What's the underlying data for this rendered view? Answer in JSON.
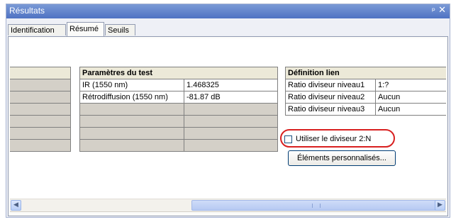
{
  "window": {
    "title": "Résultats",
    "pin_glyph": "ᵖ",
    "close_glyph": "✕"
  },
  "tabs": [
    {
      "label": "Identification",
      "active": false
    },
    {
      "label": "Résumé",
      "active": true
    },
    {
      "label": "Seuils",
      "active": false
    }
  ],
  "params_table": {
    "header": "Paramètres du test",
    "rows": [
      {
        "label": "IR (1550 nm)",
        "value": "1.468325"
      },
      {
        "label": "Rétrodiffusion (1550 nm)",
        "value": "-81.87 dB"
      }
    ]
  },
  "link_table": {
    "header": "Définition lien",
    "rows": [
      {
        "label": "Ratio diviseur niveau1",
        "value": "1:?"
      },
      {
        "label": "Ratio diviseur niveau2",
        "value": "Aucun"
      },
      {
        "label": "Ratio diviseur niveau3",
        "value": "Aucun"
      }
    ]
  },
  "options": {
    "use_divider_label": "Utiliser le diviseur 2:N",
    "use_divider_checked": false,
    "custom_elements_button": "Éléments personnalisés..."
  },
  "scrollbar": {
    "left_arrow": "◀",
    "right_arrow": "▶"
  }
}
